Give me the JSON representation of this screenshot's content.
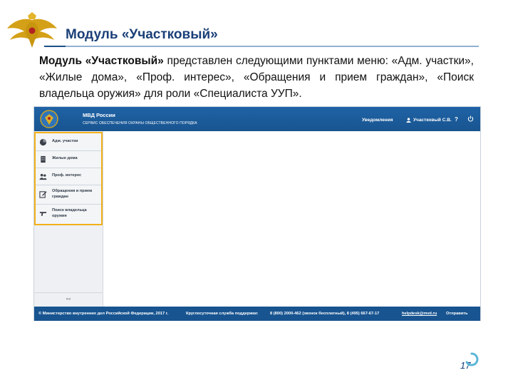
{
  "slide": {
    "title": "Модуль «Участковый»",
    "description_bold": "Модуль «Участковый»",
    "description_rest": " представлен следующими пунктами меню: «Адм. участки», «Жилые дома», «Проф. интерес», «Обращения и прием граждан», «Поиск владельца оружия» для роли «Специалиста УУП».",
    "page_number": "17"
  },
  "app": {
    "header": {
      "app_name": "МВД России",
      "subtitle": "СЕРВИС ОБЕСПЕЧЕНИЯ ОХРАНЫ ОБЩЕСТВЕННОГО ПОРЯДКА",
      "notifications": "Уведомления",
      "user": "Участковый С.В.",
      "help": "?"
    },
    "sidebar": {
      "items": [
        {
          "label": "Адм. участки",
          "icon": "pie-chart-icon"
        },
        {
          "label": "Жилые дома",
          "icon": "building-icon"
        },
        {
          "label": "Проф. интерес",
          "icon": "people-icon"
        },
        {
          "label": "Обращения и прием граждан",
          "icon": "edit-icon"
        },
        {
          "label": "Поиск владельца оружия",
          "icon": "pistol-icon"
        }
      ],
      "collapse": "««"
    },
    "footer": {
      "copyright": "© Министерство внутренних дел Российской Федерации, 2017 г.",
      "support": "Круглосуточная служба поддержки:",
      "phones": "8 (800) 2000-462 (звонок бесплатный), 8 (495) 667-67-17",
      "email": "helpdesk@mvd.ru",
      "send": "Отправить"
    }
  },
  "colors": {
    "header_blue": "#1f63a6",
    "highlight_orange": "#f2b019",
    "title_blue": "#1a3f78"
  }
}
